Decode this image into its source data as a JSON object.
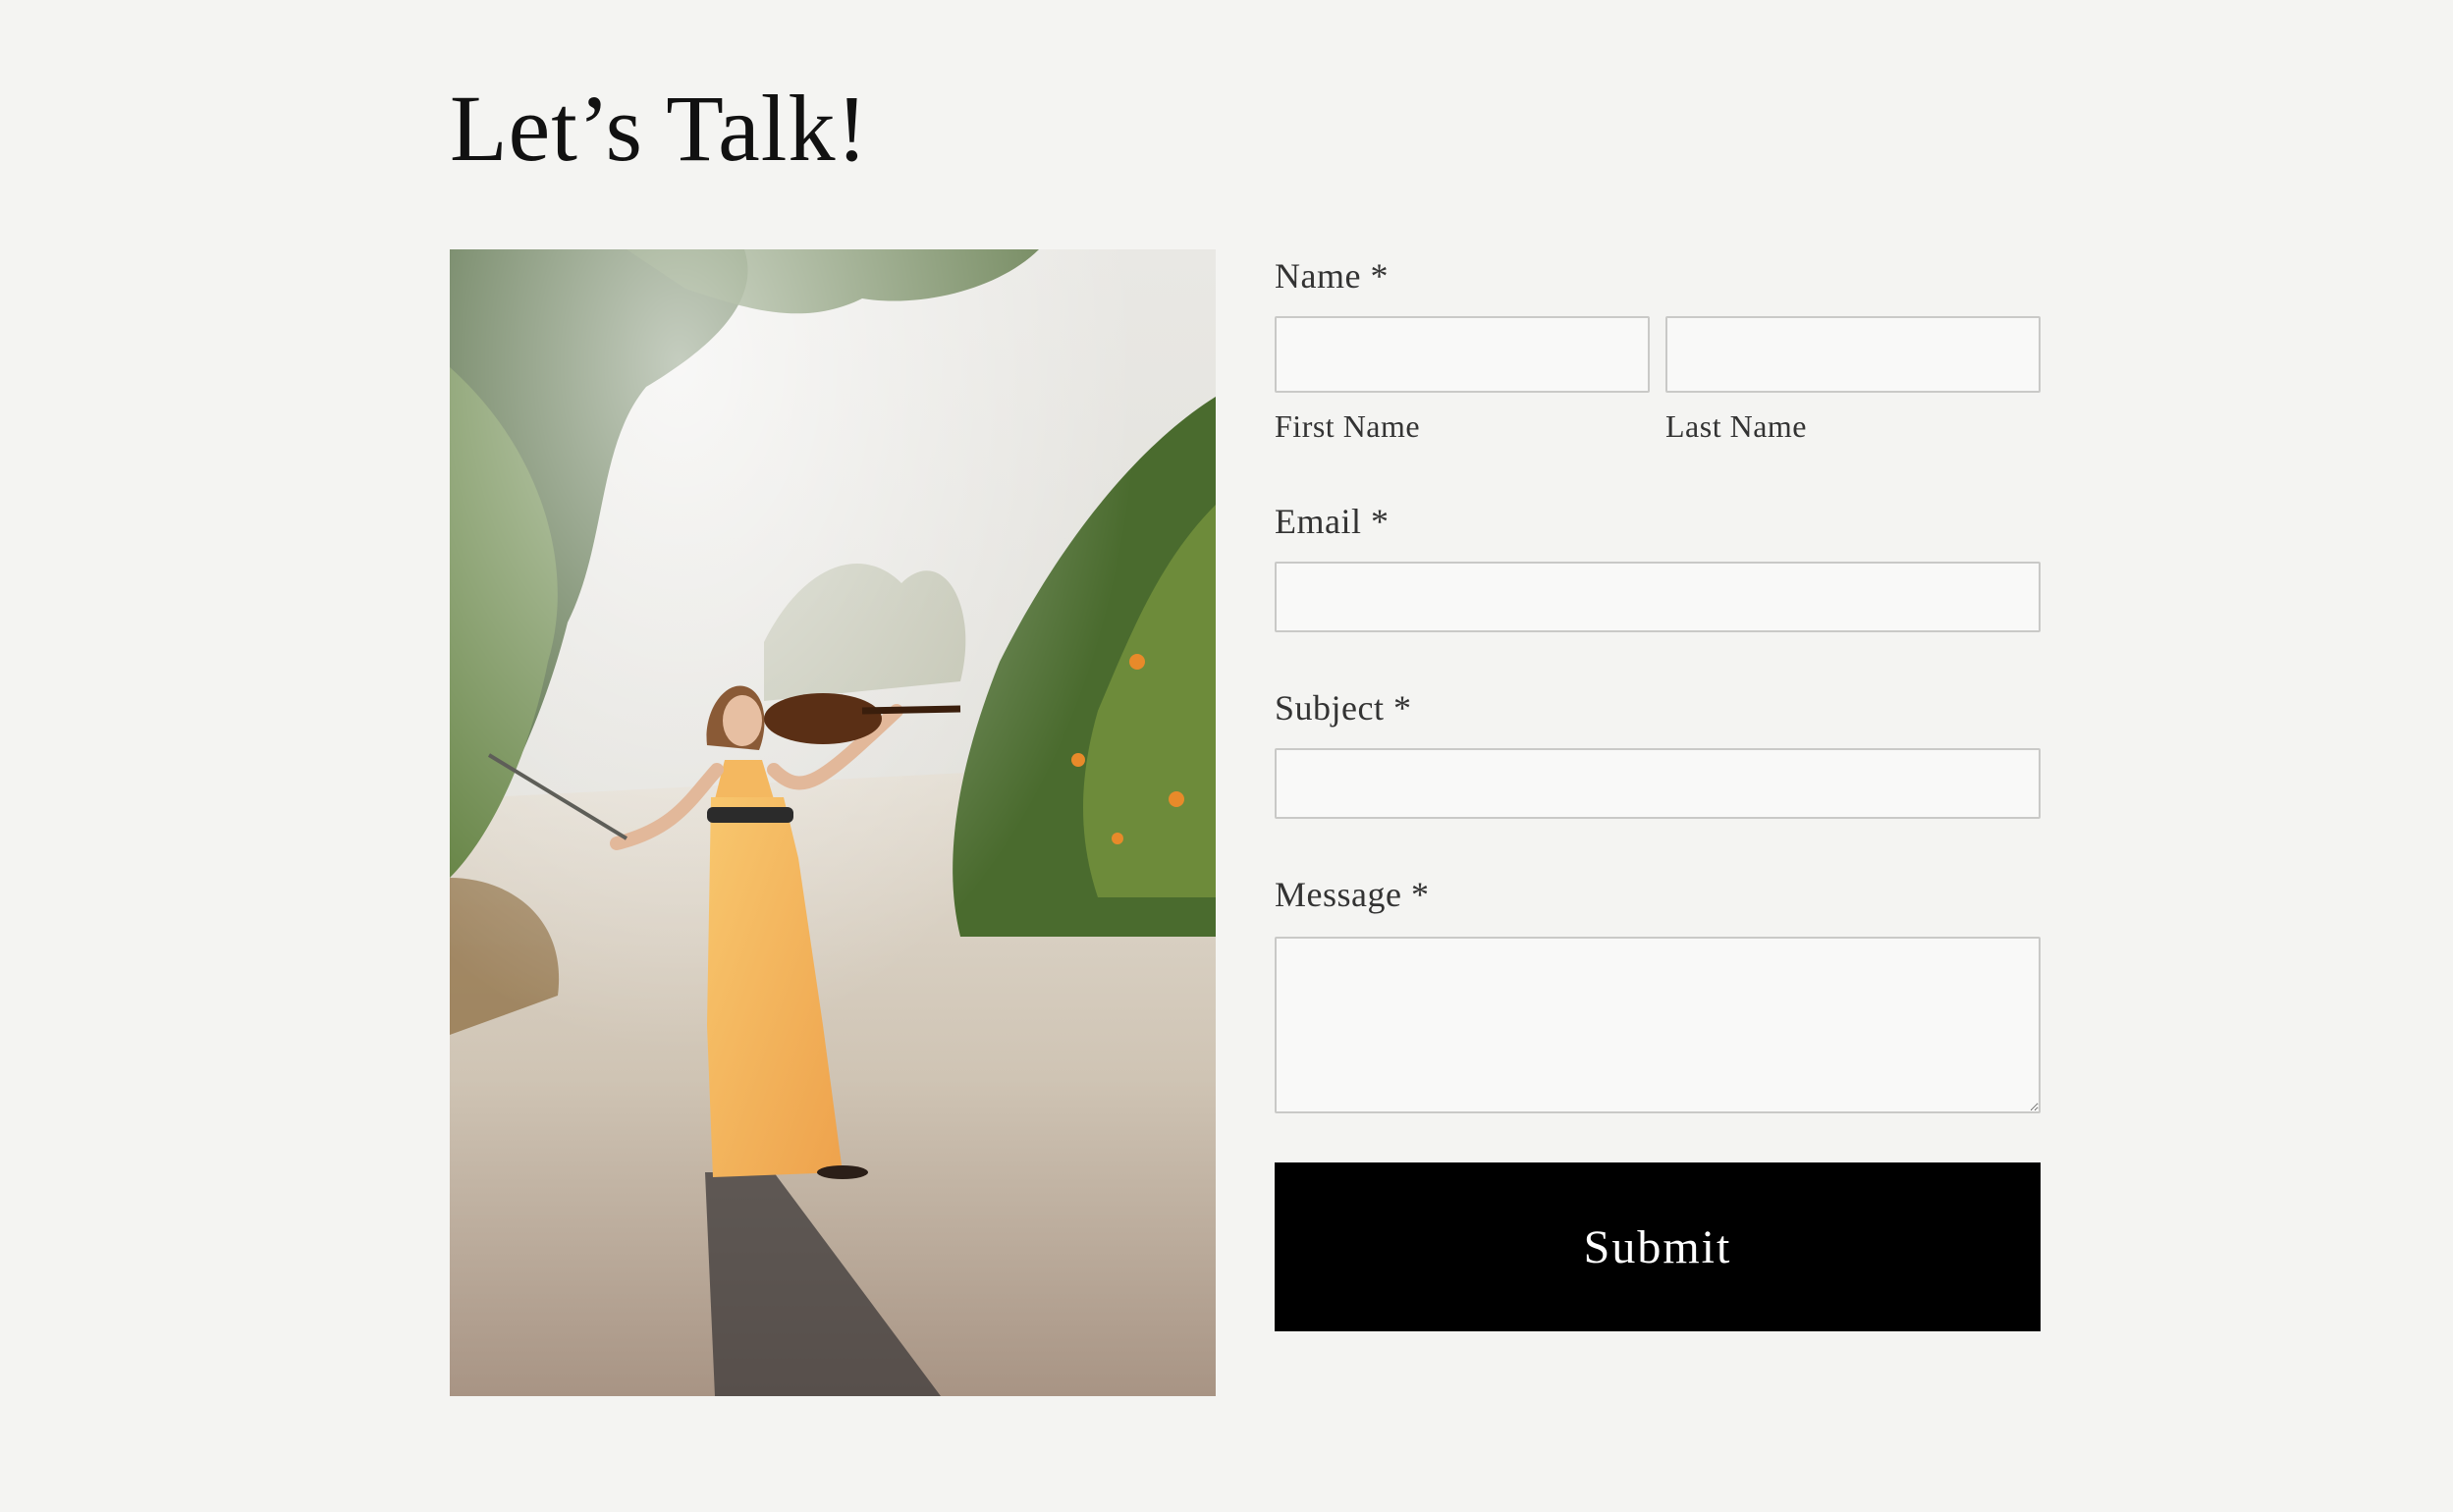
{
  "page": {
    "title": "Let’s Talk!"
  },
  "form": {
    "name": {
      "label": "Name *",
      "first_sublabel": "First Name",
      "last_sublabel": "Last Name",
      "first_value": "",
      "last_value": ""
    },
    "email": {
      "label": "Email *",
      "value": ""
    },
    "subject": {
      "label": "Subject *",
      "value": ""
    },
    "message": {
      "label": "Message *",
      "value": ""
    },
    "submit_label": "Submit"
  },
  "colors": {
    "background": "#f4f4f2",
    "button": "#000000",
    "button_text": "#ffffff",
    "field_border": "#c9c9c7",
    "dress": "#f4b860"
  }
}
